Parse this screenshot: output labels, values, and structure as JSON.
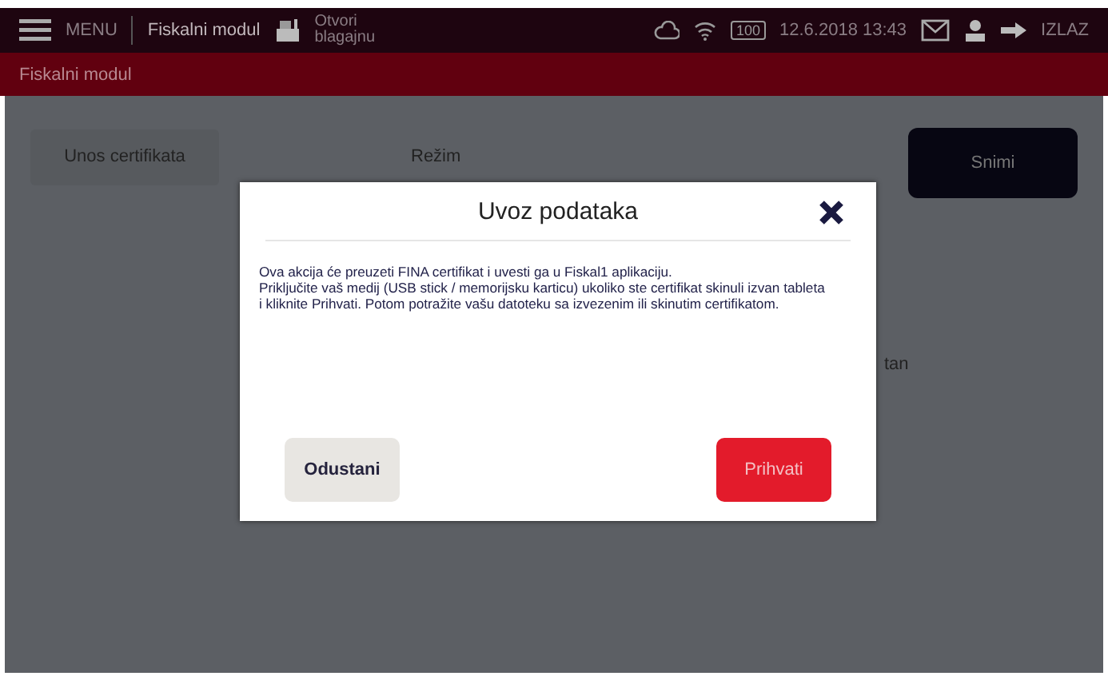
{
  "top_bar": {
    "menu_label": "MENU",
    "module_title": "Fiskalni modul",
    "register_action": "Otvori blagajnu",
    "battery": "100",
    "datetime": "12.6.2018 13:43",
    "logout_label": "IZLAZ"
  },
  "breadcrumb": "Fiskalni modul",
  "content": {
    "certificate_button": "Unos certifikata",
    "mode_label": "Režim",
    "save_button": "Snimi",
    "partial_text": "tan"
  },
  "dialog": {
    "title": "Uvoz podataka",
    "message_lines": [
      "Ova akcija će preuzeti FINA certifikat i uvesti ga u Fiskal1 aplikaciju.",
      " Priključite vaš medij (USB stick / memorijsku karticu) ukoliko ste certifikat skinuli izvan tableta",
      " i kliknite Prihvati. Potom potražite vašu datoteku sa izvezenim ili skinutim certifikatom."
    ],
    "buttons": [
      {
        "label": "Odustani",
        "kind": "secondary"
      },
      {
        "label": "Prihvati",
        "kind": "primary"
      }
    ]
  }
}
